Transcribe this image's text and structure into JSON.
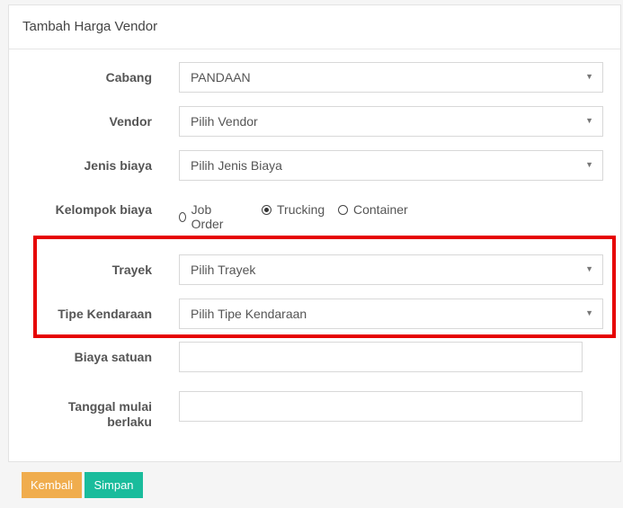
{
  "panel": {
    "title": "Tambah Harga Vendor"
  },
  "form": {
    "cabang": {
      "label": "Cabang",
      "value": "PANDAAN"
    },
    "vendor": {
      "label": "Vendor",
      "value": "Pilih Vendor"
    },
    "jenis_biaya": {
      "label": "Jenis biaya",
      "value": "Pilih Jenis Biaya"
    },
    "kelompok_biaya": {
      "label": "Kelompok biaya",
      "options": [
        {
          "label": "Job Order",
          "checked": false
        },
        {
          "label": "Trucking",
          "checked": true
        },
        {
          "label": "Container",
          "checked": false
        }
      ]
    },
    "trayek": {
      "label": "Trayek",
      "value": "Pilih Trayek"
    },
    "tipe_kendaraan": {
      "label": "Tipe Kendaraan",
      "value": "Pilih Tipe Kendaraan"
    },
    "biaya_satuan": {
      "label": "Biaya satuan",
      "value": ""
    },
    "tanggal_mulai": {
      "label_line1": "Tanggal mulai",
      "label_line2": "berlaku",
      "value": ""
    }
  },
  "footer": {
    "back_label": "Kembali",
    "save_label": "Simpan"
  },
  "colors": {
    "highlight": "#e60000",
    "back_button": "#f0ad4e",
    "save_button": "#1abc9c"
  },
  "icons": {
    "select_caret": "caret-down-icon"
  }
}
